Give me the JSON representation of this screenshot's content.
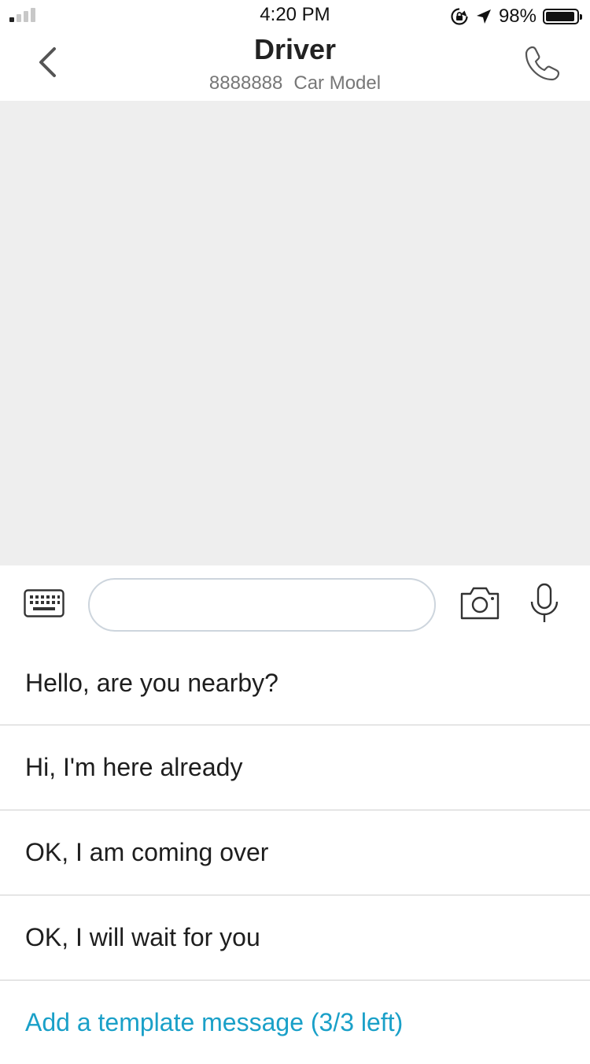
{
  "status_bar": {
    "time": "4:20 PM",
    "battery_percent": "98%",
    "battery_level": 0.98,
    "signal_bars_active": 1,
    "signal_bars_total": 4,
    "icons": [
      "signal-icon",
      "orientation-lock-icon",
      "location-arrow-icon",
      "battery-icon"
    ]
  },
  "header": {
    "title": "Driver",
    "plate": "8888888",
    "car_model": "Car Model",
    "back_icon": "chevron-left-icon",
    "call_icon": "phone-icon"
  },
  "input_bar": {
    "placeholder": "",
    "value": "",
    "icons": [
      "keyboard-icon",
      "camera-icon",
      "microphone-icon"
    ]
  },
  "templates": {
    "items": [
      "Hello, are you nearby?",
      "Hi, I'm here already",
      "OK, I am coming over",
      "OK, I will wait for you"
    ],
    "add_label": "Add a template message (3/3 left)"
  },
  "colors": {
    "accent": "#1aa0c8",
    "chat_background": "#eeeeee",
    "divider": "#cfcfcf",
    "input_border": "#cdd5dd"
  }
}
